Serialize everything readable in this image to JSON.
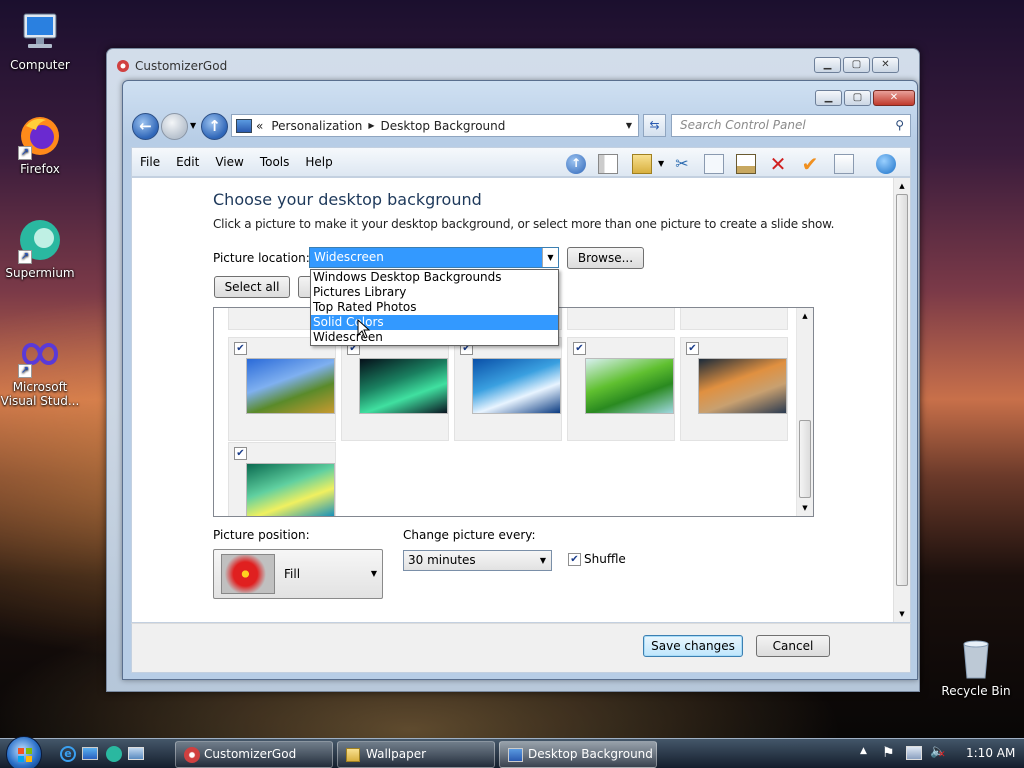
{
  "desktop": {
    "icons": [
      {
        "label": "Computer"
      },
      {
        "label": "Firefox"
      },
      {
        "label": "Supermium"
      },
      {
        "label": "Microsoft Visual Stud..."
      },
      {
        "label": "Recycle Bin"
      }
    ]
  },
  "outer_window": {
    "title": "CustomizerGod"
  },
  "inner_window": {
    "breadcrumb": {
      "prefix": "«",
      "items": [
        "Personalization",
        "Desktop Background"
      ]
    },
    "search_placeholder": "Search Control Panel",
    "menu": [
      "File",
      "Edit",
      "View",
      "Tools",
      "Help"
    ],
    "heading": "Choose your desktop background",
    "description": "Click a picture to make it your desktop background, or select more than one picture to create a slide show.",
    "picture_location_label": "Picture location:",
    "picture_location_value": "Widescreen",
    "browse_label": "Browse...",
    "select_all_label": "Select all",
    "location_options": [
      {
        "label": "Windows Desktop Backgrounds",
        "selected": false
      },
      {
        "label": "Pictures Library",
        "selected": false
      },
      {
        "label": "Top Rated Photos",
        "selected": false
      },
      {
        "label": "Solid Colors",
        "selected": true
      },
      {
        "label": "Widescreen",
        "selected": false
      }
    ],
    "gallery": [
      {
        "name": "hills",
        "checked": true,
        "colors": [
          "#2a6ad8",
          "#7fb0f0",
          "#5a8a2a",
          "#c89a30"
        ]
      },
      {
        "name": "aurora",
        "checked": true,
        "colors": [
          "#05101a",
          "#1a8060",
          "#40e0a0",
          "#0a1420"
        ]
      },
      {
        "name": "fish",
        "checked": true,
        "colors": [
          "#0a50a8",
          "#3aa0e0",
          "#e8f4ff",
          "#0a3a80"
        ]
      },
      {
        "name": "palm",
        "checked": true,
        "colors": [
          "#d8f0f0",
          "#60c030",
          "#2a8a20",
          "#a0d8e0"
        ]
      },
      {
        "name": "rocks",
        "checked": true,
        "colors": [
          "#1a2a3a",
          "#e09040",
          "#c8a070",
          "#2a3a50"
        ]
      },
      {
        "name": "aero",
        "checked": true,
        "colors": [
          "#0a6a50",
          "#60d0a0",
          "#f0f060",
          "#0a8ac0"
        ]
      }
    ],
    "picture_position_label": "Picture position:",
    "picture_position_value": "Fill",
    "change_every_label": "Change picture every:",
    "change_every_value": "30 minutes",
    "shuffle_label": "Shuffle",
    "shuffle_checked": true,
    "save_label": "Save changes",
    "cancel_label": "Cancel"
  },
  "taskbar": {
    "items": [
      {
        "label": "CustomizerGod",
        "active": false
      },
      {
        "label": "Wallpaper",
        "active": false
      },
      {
        "label": "Desktop Background",
        "active": true
      }
    ],
    "clock": "1:10 AM"
  }
}
